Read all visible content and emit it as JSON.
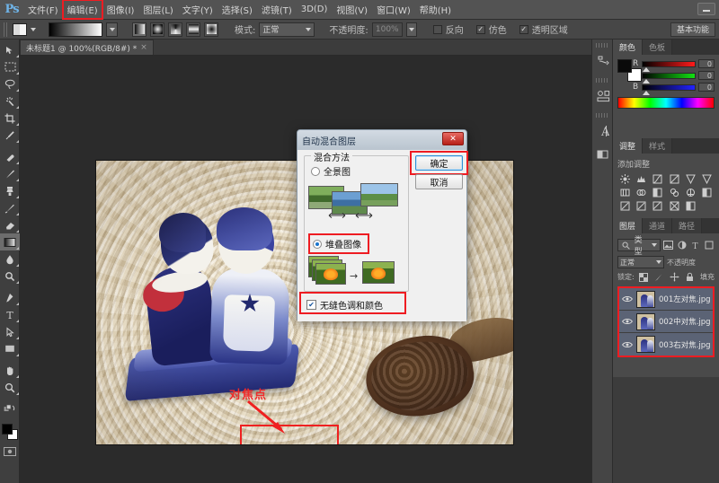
{
  "app": {
    "name": "Ps",
    "workspace_button": "基本功能",
    "minimize_label": "—"
  },
  "menubar": {
    "items": [
      {
        "label": "文件(F)",
        "highlighted": false
      },
      {
        "label": "编辑(E)",
        "highlighted": true
      },
      {
        "label": "图像(I)",
        "highlighted": false
      },
      {
        "label": "图层(L)",
        "highlighted": false
      },
      {
        "label": "文字(Y)",
        "highlighted": false
      },
      {
        "label": "选择(S)",
        "highlighted": false
      },
      {
        "label": "滤镜(T)",
        "highlighted": false
      },
      {
        "label": "3D(D)",
        "highlighted": false
      },
      {
        "label": "视图(V)",
        "highlighted": false
      },
      {
        "label": "窗口(W)",
        "highlighted": false
      },
      {
        "label": "帮助(H)",
        "highlighted": false
      }
    ]
  },
  "options_bar": {
    "mode_label": "模式:",
    "mode_value": "正常",
    "opacity_label": "不透明度:",
    "opacity_value": "100%",
    "reverse_label": "反向",
    "dither_label": "仿色",
    "transparency_label": "透明区域"
  },
  "document_tab": {
    "title": "未标题1 @ 100%(RGB/8#) *",
    "close": "×"
  },
  "canvas": {
    "annotation_label": "对焦点"
  },
  "dialog": {
    "title": "自动混合图层",
    "close_label": "✕",
    "group_legend": "混合方法",
    "option_panorama": "全景图",
    "option_stack": "堆叠图像",
    "checkbox_seamless": "无缝色调和颜色",
    "seamless_checked": true,
    "selected_option": "堆叠图像",
    "ok_button": "确定",
    "cancel_button": "取消",
    "highlight_color": "#ee1c22"
  },
  "color_panel": {
    "tabs": [
      "颜色",
      "色板"
    ],
    "active_tab": "颜色",
    "channels": [
      {
        "label": "R",
        "value": "0"
      },
      {
        "label": "G",
        "value": "0"
      },
      {
        "label": "B",
        "value": "0"
      }
    ]
  },
  "adjustments_panel": {
    "tabs": [
      "调整",
      "样式"
    ],
    "active_tab": "调整",
    "title": "添加调整",
    "icons": [
      "brightness-icon",
      "levels-icon",
      "curves-icon",
      "exposure-icon",
      "vibrance-icon",
      "hue-sat-icon",
      "color-balance-icon",
      "bw-icon",
      "photo-filter-icon",
      "channel-mixer-icon",
      "color-lookup-icon",
      "invert-icon",
      "posterize-icon",
      "threshold-icon",
      "gradient-map-icon",
      "selective-color-icon",
      "duotone-icon",
      "empty-icon"
    ]
  },
  "layers_panel": {
    "tabs": [
      "图层",
      "通道",
      "路径"
    ],
    "active_tab": "图层",
    "filter_label": "类型",
    "blend_mode": "正常",
    "opacity_label": "不透明度",
    "lock_label": "锁定:",
    "fill_label": "填充",
    "layers": [
      {
        "name": "001左对焦.jpg",
        "visible": true
      },
      {
        "name": "002中对焦.jpg",
        "visible": true
      },
      {
        "name": "003右对焦.jpg",
        "visible": true
      }
    ],
    "highlight_color": "#ee1c22"
  },
  "toolbar": {
    "tools": [
      "move-tool",
      "marquee-tool",
      "lasso-tool",
      "magic-wand-tool",
      "crop-tool",
      "eyedropper-tool",
      "healing-brush-tool",
      "brush-tool",
      "clone-stamp-tool",
      "history-brush-tool",
      "eraser-tool",
      "gradient-tool",
      "blur-tool",
      "dodge-tool",
      "pen-tool",
      "type-tool",
      "path-selection-tool",
      "rectangle-tool",
      "hand-tool",
      "zoom-tool"
    ],
    "selected_tool": "gradient-tool"
  },
  "icon_strip": {
    "icons": [
      "history-icon",
      "actions-icon",
      "character-icon",
      "layer-comps-icon"
    ]
  }
}
